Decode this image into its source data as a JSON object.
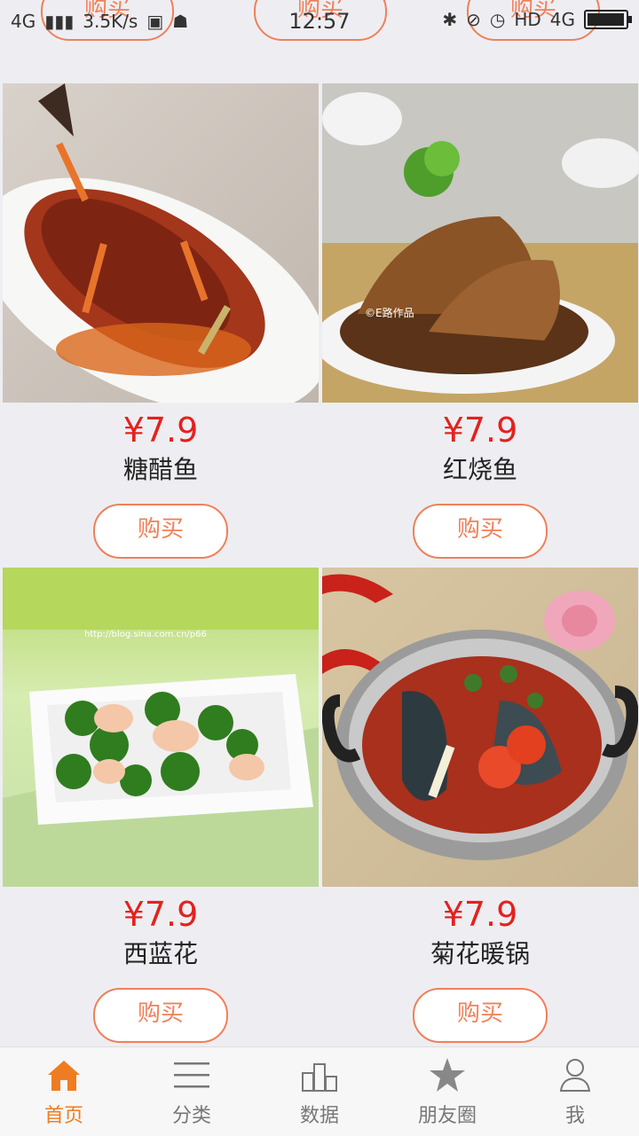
{
  "status_bar": {
    "network": "4G",
    "speed": "3.5K/s",
    "time": "12:57",
    "hd": "HD",
    "network_right": "4G"
  },
  "peek_buttons": [
    "购买",
    "购买",
    "购买"
  ],
  "products": [
    {
      "price": "¥7.9",
      "name": "糖醋鱼",
      "buy_label": "购买",
      "photo_watermark": ""
    },
    {
      "price": "¥7.9",
      "name": "红烧鱼",
      "buy_label": "购买",
      "photo_watermark": "©E路作品"
    },
    {
      "price": "¥7.9",
      "name": "西蓝花",
      "buy_label": "购买",
      "photo_watermark": "http://blog.sina.com.cn/p66"
    },
    {
      "price": "¥7.9",
      "name": "菊花暖锅",
      "buy_label": "购买",
      "photo_watermark": ""
    }
  ],
  "bottom_nav": [
    {
      "label": "首页",
      "icon": "home-icon",
      "active": true
    },
    {
      "label": "分类",
      "icon": "list-icon",
      "active": false
    },
    {
      "label": "数据",
      "icon": "podium-icon",
      "active": false
    },
    {
      "label": "朋友圈",
      "icon": "star-icon",
      "active": false
    },
    {
      "label": "我",
      "icon": "person-icon",
      "active": false
    }
  ],
  "colors": {
    "accent": "#f0805a",
    "price": "#e4211e",
    "nav_active": "#f07c20",
    "background": "#eeeef2"
  }
}
